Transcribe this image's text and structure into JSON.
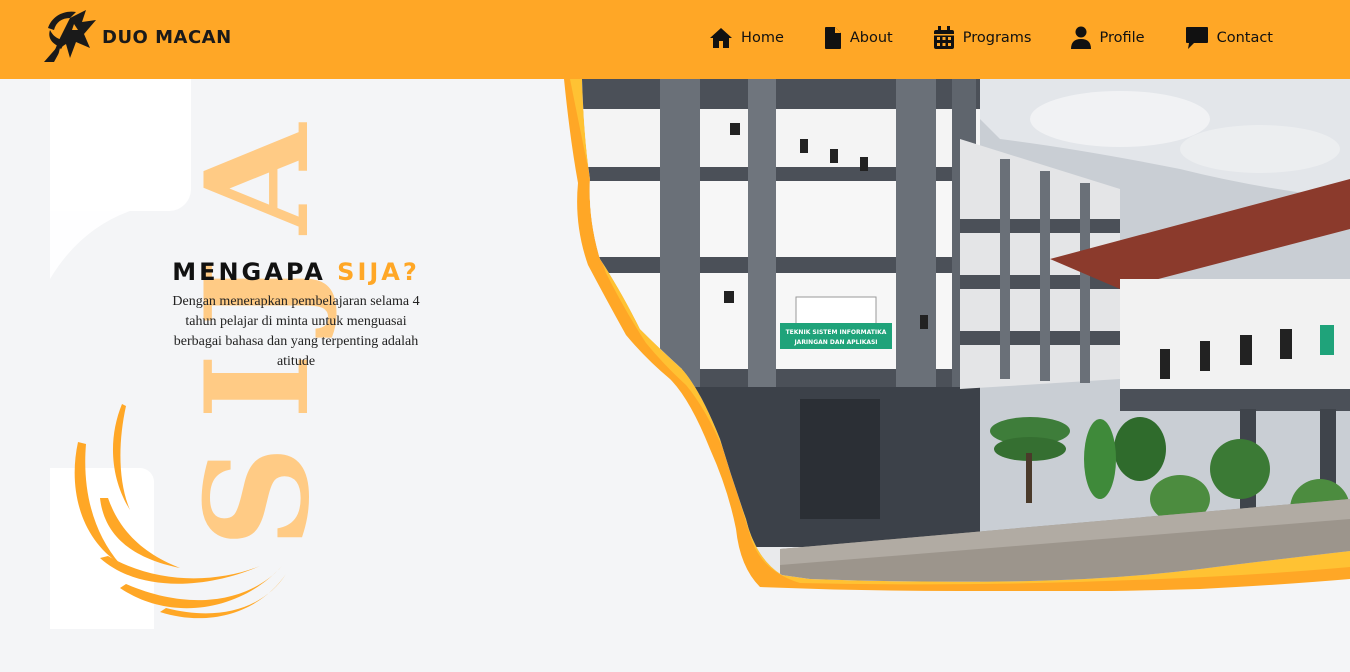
{
  "brand": {
    "name": "DUO MACAN",
    "icon": "tiger-logo-icon"
  },
  "nav": {
    "items": [
      {
        "label": "Home",
        "icon": "home-icon"
      },
      {
        "label": "About",
        "icon": "document-icon"
      },
      {
        "label": "Programs",
        "icon": "calendar-icon"
      },
      {
        "label": "Profile",
        "icon": "user-icon"
      },
      {
        "label": "Contact",
        "icon": "chat-icon"
      }
    ]
  },
  "hero": {
    "title_main": "MENGAPA",
    "title_accent": "SIJA?",
    "description": "Dengan menerapkan pembelajaran selama 4 tahun pelajar di minta untuk menguasai berbagai bahasa dan yang terpenting adalah atitude",
    "watermark": "SIJA"
  },
  "photo": {
    "sign_line1": "TEKNIK SISTEM INFORMATIKA",
    "sign_line2": "JARINGAN DAN APLIKASI"
  },
  "colors": {
    "accent": "#ffa726",
    "background": "#f4f5f7",
    "text": "#111111",
    "watermark": "#ffcb85"
  }
}
